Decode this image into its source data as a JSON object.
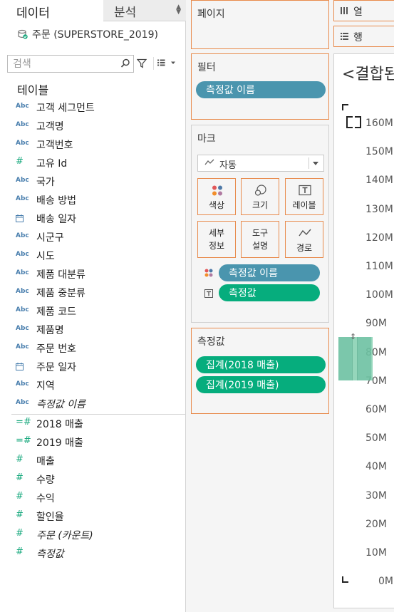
{
  "tabs": {
    "data": "데이터",
    "analysis": "분석"
  },
  "datasource": {
    "name": "주문 (SUPERSTORE_2019)"
  },
  "search": {
    "placeholder": "검색"
  },
  "section": {
    "table": "테이블"
  },
  "dimensions": [
    {
      "type": "Abc",
      "name": "고객 세그먼트"
    },
    {
      "type": "Abc",
      "name": "고객명"
    },
    {
      "type": "Abc",
      "name": "고객번호"
    },
    {
      "type": "#",
      "name": "고유 Id"
    },
    {
      "type": "Abc",
      "name": "국가"
    },
    {
      "type": "Abc",
      "name": "배송 방법"
    },
    {
      "type": "date",
      "name": "배송 일자"
    },
    {
      "type": "Abc",
      "name": "시군구"
    },
    {
      "type": "Abc",
      "name": "시도"
    },
    {
      "type": "Abc",
      "name": "제품 대분류"
    },
    {
      "type": "Abc",
      "name": "제품 중분류"
    },
    {
      "type": "Abc",
      "name": "제품 코드"
    },
    {
      "type": "Abc",
      "name": "제품명"
    },
    {
      "type": "Abc",
      "name": "주문 번호"
    },
    {
      "type": "date",
      "name": "주문 일자"
    },
    {
      "type": "Abc",
      "name": "지역"
    },
    {
      "type": "Abc",
      "name": "측정값 이름"
    }
  ],
  "measures": [
    {
      "type": "=#",
      "name": "2018 매출"
    },
    {
      "type": "=#",
      "name": "2019 매출"
    },
    {
      "type": "#",
      "name": "매출"
    },
    {
      "type": "#",
      "name": "수량"
    },
    {
      "type": "#",
      "name": "수익"
    },
    {
      "type": "#",
      "name": "할인율"
    },
    {
      "type": "#",
      "name": "주문 (카운트)"
    },
    {
      "type": "#",
      "name": "측정값"
    }
  ],
  "pages": {
    "title": "페이지"
  },
  "filters": {
    "title": "필터",
    "pill": "측정값 이름"
  },
  "marks": {
    "title": "마크",
    "type": "자동",
    "buttons": {
      "color": "색상",
      "size": "크기",
      "label": "레이블",
      "detail": "세부\n정보",
      "tooltip": "도구\n설명",
      "path": "경로"
    },
    "encodings": [
      {
        "icon": "color-dots-icon",
        "label": "측정값 이름"
      },
      {
        "icon": "label-T-icon",
        "label": "측정값"
      }
    ]
  },
  "measure_values": {
    "title": "측정값",
    "pills": [
      "집계(2018 매출)",
      "집계(2019 매출)"
    ]
  },
  "shelves": {
    "columns": "열",
    "rows": "행"
  },
  "view": {
    "title": "<결합된",
    "axis_ticks": [
      "160M",
      "150M",
      "140M",
      "130M",
      "120M",
      "110M",
      "100M",
      "90M",
      "80M",
      "70M",
      "60M",
      "50M",
      "40M",
      "30M",
      "20M",
      "10M",
      "0M"
    ]
  },
  "colors": {
    "accent_border": "#e88a4b",
    "pill_blue": "#4a95ae",
    "pill_green": "#06ad7d"
  }
}
